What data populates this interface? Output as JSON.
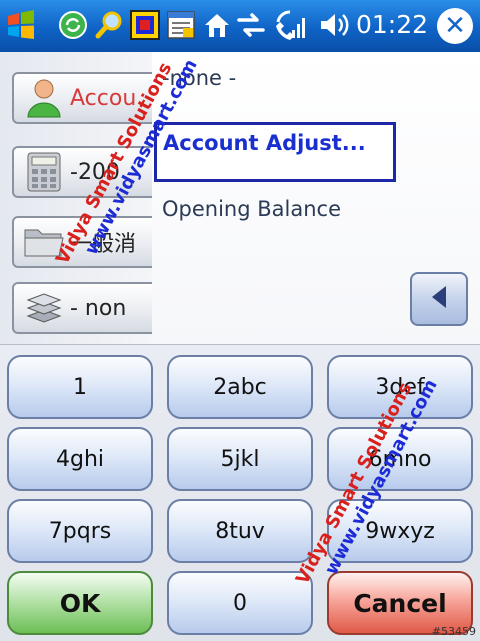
{
  "taskbar": {
    "clock": "01:22",
    "icons": [
      "windows-start-icon",
      "refresh-icon",
      "search-icon",
      "window-icon",
      "notes-icon",
      "home-icon",
      "sync-icon",
      "phone-signal-icon",
      "volume-icon",
      "close-icon"
    ],
    "close_glyph": "✕"
  },
  "sidebar": {
    "items": [
      {
        "label": "Accou",
        "icon": "user-icon"
      },
      {
        "label": "-200",
        "icon": "calculator-icon"
      },
      {
        "label": "一般消",
        "icon": "folder-icon"
      },
      {
        "label": "- non",
        "icon": "stack-icon"
      }
    ]
  },
  "dropdown": {
    "options": [
      "-none -",
      "Account Adjust...",
      "Opening Balance"
    ],
    "selected": "Account Adjust..."
  },
  "keypad": {
    "keys": [
      "1",
      "2abc",
      "3def",
      "4ghi",
      "5jkl",
      "6mno",
      "7pqrs",
      "8tuv",
      "9wxyz"
    ],
    "ok": "OK",
    "zero": "0",
    "cancel": "Cancel"
  },
  "watermark": {
    "line1": "Vidya Smart Solutions",
    "line2": "www.vidyasmart.com"
  },
  "image_tag": "#53459",
  "colors": {
    "taskbar": "#1565c8",
    "selected_text": "#1a2fd0",
    "ok": "#6cbe56",
    "cancel": "#e05a48"
  }
}
